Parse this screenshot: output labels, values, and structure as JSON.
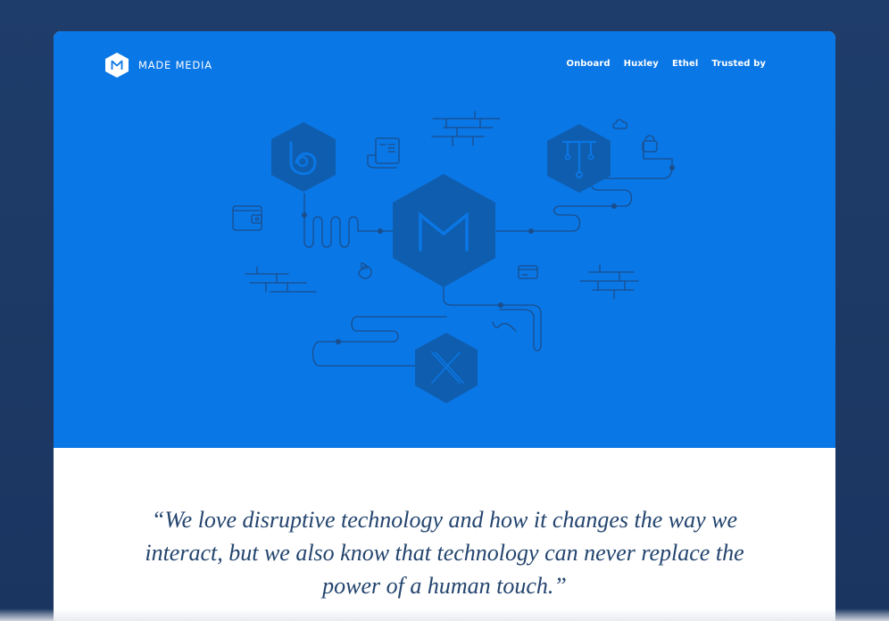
{
  "header": {
    "brand": "MADE MEDIA",
    "logo_icon": "m-hexagon-icon",
    "nav": [
      {
        "label": "Onboard"
      },
      {
        "label": "Huxley"
      },
      {
        "label": "Ethel"
      },
      {
        "label": "Trusted by"
      }
    ]
  },
  "hero": {
    "background_color": "#0a77e6",
    "line_color": "#1a4e8c",
    "hexagon_color": "#0f5dae",
    "icons": [
      "b-brand-hexagon-icon",
      "t-brand-hexagon-icon",
      "m-brand-hexagon-icon",
      "x-brand-hexagon-icon",
      "wallet-icon",
      "document-icon",
      "cloud-icon",
      "padlock-icon",
      "pie-chart-icon",
      "credit-card-icon",
      "brick-wall-icon"
    ]
  },
  "quote": {
    "text": "“We love disruptive technology and how it changes the way we interact, but we also know that technology can never replace the power of a human touch.”",
    "color": "#23446e"
  },
  "page": {
    "background_color": "#1d3a66"
  }
}
